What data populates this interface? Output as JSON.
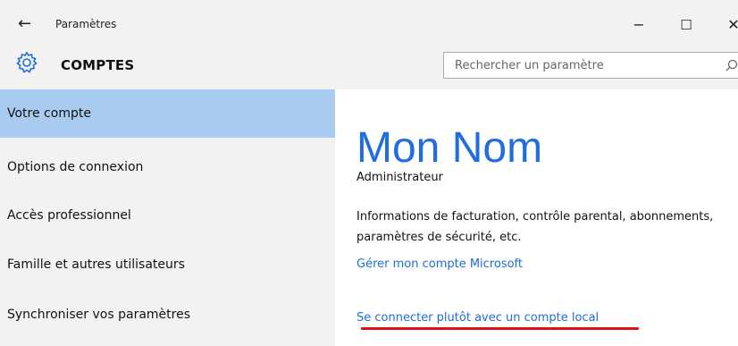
{
  "window": {
    "title": "Paramètres",
    "back_icon": "←",
    "minimize_icon": "−",
    "maximize_icon": "☐",
    "close_icon": "✕"
  },
  "header": {
    "section_title": "COMPTES",
    "search_placeholder": "Rechercher un paramètre"
  },
  "sidebar": {
    "items": [
      {
        "label": "Votre compte",
        "active": true
      },
      {
        "label": "Options de connexion",
        "active": false
      },
      {
        "label": "Accès professionnel",
        "active": false
      },
      {
        "label": "Famille et autres utilisateurs",
        "active": false
      },
      {
        "label": "Synchroniser vos paramètres",
        "active": false
      }
    ]
  },
  "main": {
    "user_name": "Mon Nom",
    "role": "Administrateur",
    "info_text": "Informations de facturation, contrôle parental, abonnements, paramètres de sécurité, etc.",
    "manage_link": "Gérer mon compte Microsoft",
    "local_link": "Se connecter plutôt avec un compte local"
  },
  "colors": {
    "accent": "#1f6de0",
    "link": "#1a6ed8",
    "active_nav": "#aacbf0",
    "annotation_red": "#e01010"
  }
}
